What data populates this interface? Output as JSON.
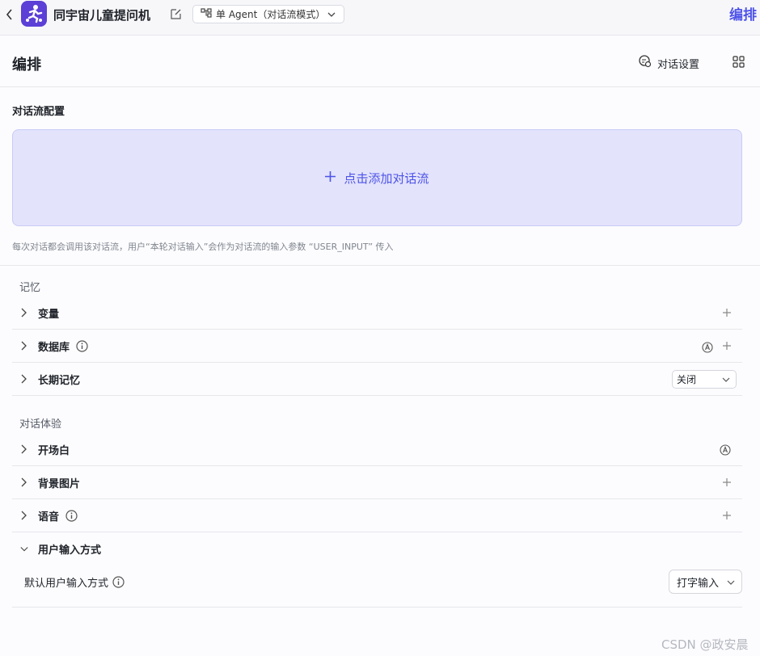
{
  "topbar": {
    "app_name": "同宇宙儿童提问机",
    "mode_label": "单 Agent（对话流模式）",
    "right_title": "编排"
  },
  "header": {
    "title": "编排",
    "settings_label": "对话设置"
  },
  "flow_config": {
    "title": "对话流配置",
    "add_label": "点击添加对话流",
    "hint": "每次对话都会调用该对话流，用户“本轮对话输入”会作为对话流的输入参数 “USER_INPUT” 传入"
  },
  "memory": {
    "title": "记忆",
    "items": [
      {
        "label": "变量"
      },
      {
        "label": "数据库"
      },
      {
        "label": "长期记忆",
        "value": "关闭"
      }
    ]
  },
  "experience": {
    "title": "对话体验",
    "items": [
      {
        "label": "开场白"
      },
      {
        "label": "背景图片"
      },
      {
        "label": "语音"
      },
      {
        "label": "用户输入方式"
      }
    ],
    "default_input_label": "默认用户输入方式",
    "default_input_value": "打字输入"
  },
  "watermark": "CSDN @政安晨",
  "colors": {
    "accent": "#4d53e8",
    "add_flow_bg": "#e3e3fc",
    "app_icon_bg": "#5b3fd6"
  }
}
